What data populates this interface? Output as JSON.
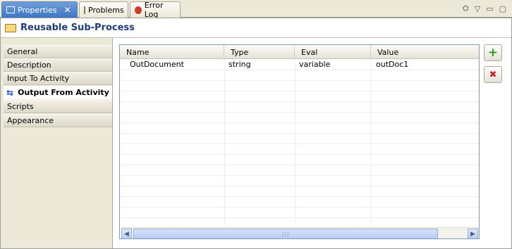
{
  "tabs": [
    {
      "label": "Properties",
      "close": "✕",
      "icon": "properties-icon"
    },
    {
      "label": "Problems",
      "icon": "problems-icon"
    },
    {
      "label": "Error Log",
      "icon": "error-log-icon"
    }
  ],
  "view_toolbar": {
    "sync_glyph": "⛭",
    "menu_glyph": "▽",
    "minimize_glyph": "▭",
    "maximize_glyph": "▢"
  },
  "title": "Reusable Sub-Process",
  "categories": [
    {
      "label": "General"
    },
    {
      "label": "Description"
    },
    {
      "label": "Input To Activity"
    },
    {
      "label": "Output From Activity",
      "selected": true
    },
    {
      "label": "Scripts"
    },
    {
      "label": "Appearance"
    }
  ],
  "table": {
    "columns": [
      "Name",
      "Type",
      "Eval",
      "Value"
    ],
    "rows": [
      [
        "OutDocument",
        "string",
        "variable",
        "outDoc1"
      ]
    ]
  },
  "buttons": {
    "add": "+",
    "delete": "✖"
  },
  "colors": {
    "accent": "#3f76c4",
    "title": "#1f3c75",
    "add": "#2f9b1e",
    "delete": "#d22222"
  }
}
